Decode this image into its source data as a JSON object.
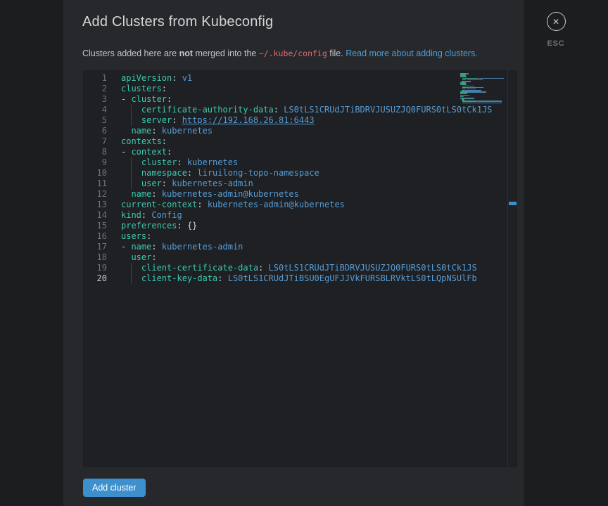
{
  "theme": {
    "accent": "#3d90ce",
    "key": "#3dc9b0",
    "value": "#569cd6",
    "punct": "#d4d4d4",
    "link_blue": "#4f9ed9",
    "code_pink": "#e06c75",
    "modal_bg": "#26282b",
    "editor_bg": "#1e2023",
    "overlay_bg": "#1b1d1f"
  },
  "modal": {
    "title": "Add Clusters from Kubeconfig",
    "close_icon": "✕",
    "esc_label": "ESC",
    "subtitle": {
      "prefix": "Clusters added here are ",
      "bold": "not",
      "middle": " merged into the ",
      "code": "~/.kube/config",
      "suffix": " file. ",
      "link": "Read more about adding clusters."
    },
    "add_button_label": "Add cluster"
  },
  "editor": {
    "active_line": 20,
    "lines": [
      {
        "no": 1,
        "tokens": [
          [
            "k",
            "apiVersion"
          ],
          [
            "p",
            ": "
          ],
          [
            "v",
            "v1"
          ]
        ]
      },
      {
        "no": 2,
        "tokens": [
          [
            "k",
            "clusters"
          ],
          [
            "p",
            ":"
          ]
        ]
      },
      {
        "no": 3,
        "tokens": [
          [
            "p",
            "- "
          ],
          [
            "k",
            "cluster"
          ],
          [
            "p",
            ":"
          ]
        ]
      },
      {
        "no": 4,
        "tokens": [
          [
            "sp",
            "  "
          ],
          [
            "g",
            ""
          ],
          [
            "k",
            "certificate-authority-data"
          ],
          [
            "p",
            ": "
          ],
          [
            "v",
            "LS0tLS1CRUdJTiBDRVJUSUZJQ0FURS0tLS0tCk1JS"
          ]
        ]
      },
      {
        "no": 5,
        "tokens": [
          [
            "sp",
            "  "
          ],
          [
            "g",
            ""
          ],
          [
            "k",
            "server"
          ],
          [
            "p",
            ": "
          ],
          [
            "l",
            "https://192.168.26.81:6443"
          ]
        ]
      },
      {
        "no": 6,
        "tokens": [
          [
            "sp",
            "  "
          ],
          [
            "k",
            "name"
          ],
          [
            "p",
            ": "
          ],
          [
            "v",
            "kubernetes"
          ]
        ]
      },
      {
        "no": 7,
        "tokens": [
          [
            "k",
            "contexts"
          ],
          [
            "p",
            ":"
          ]
        ]
      },
      {
        "no": 8,
        "tokens": [
          [
            "p",
            "- "
          ],
          [
            "k",
            "context"
          ],
          [
            "p",
            ":"
          ]
        ]
      },
      {
        "no": 9,
        "tokens": [
          [
            "sp",
            "  "
          ],
          [
            "g",
            ""
          ],
          [
            "k",
            "cluster"
          ],
          [
            "p",
            ": "
          ],
          [
            "v",
            "kubernetes"
          ]
        ]
      },
      {
        "no": 10,
        "tokens": [
          [
            "sp",
            "  "
          ],
          [
            "g",
            ""
          ],
          [
            "k",
            "namespace"
          ],
          [
            "p",
            ": "
          ],
          [
            "v",
            "liruilong-topo-namespace"
          ]
        ]
      },
      {
        "no": 11,
        "tokens": [
          [
            "sp",
            "  "
          ],
          [
            "g",
            ""
          ],
          [
            "k",
            "user"
          ],
          [
            "p",
            ": "
          ],
          [
            "v",
            "kubernetes-admin"
          ]
        ]
      },
      {
        "no": 12,
        "tokens": [
          [
            "sp",
            "  "
          ],
          [
            "k",
            "name"
          ],
          [
            "p",
            ": "
          ],
          [
            "v",
            "kubernetes-admin@kubernetes"
          ]
        ]
      },
      {
        "no": 13,
        "tokens": [
          [
            "k",
            "current-context"
          ],
          [
            "p",
            ": "
          ],
          [
            "v",
            "kubernetes-admin@kubernetes"
          ]
        ]
      },
      {
        "no": 14,
        "tokens": [
          [
            "k",
            "kind"
          ],
          [
            "p",
            ": "
          ],
          [
            "v",
            "Config"
          ]
        ]
      },
      {
        "no": 15,
        "tokens": [
          [
            "k",
            "preferences"
          ],
          [
            "p",
            ": "
          ],
          [
            "p",
            "{}"
          ]
        ]
      },
      {
        "no": 16,
        "tokens": [
          [
            "k",
            "users"
          ],
          [
            "p",
            ":"
          ]
        ]
      },
      {
        "no": 17,
        "tokens": [
          [
            "p",
            "- "
          ],
          [
            "k",
            "name"
          ],
          [
            "p",
            ": "
          ],
          [
            "v",
            "kubernetes-admin"
          ]
        ]
      },
      {
        "no": 18,
        "tokens": [
          [
            "sp",
            "  "
          ],
          [
            "k",
            "user"
          ],
          [
            "p",
            ":"
          ]
        ]
      },
      {
        "no": 19,
        "tokens": [
          [
            "sp",
            "  "
          ],
          [
            "g",
            ""
          ],
          [
            "k",
            "client-certificate-data"
          ],
          [
            "p",
            ": "
          ],
          [
            "v",
            "LS0tLS1CRUdJTiBDRVJUSUZJQ0FURS0tLS0tCk1JS"
          ]
        ]
      },
      {
        "no": 20,
        "tokens": [
          [
            "sp",
            "  "
          ],
          [
            "g",
            ""
          ],
          [
            "k",
            "client-key-data"
          ],
          [
            "p",
            ": "
          ],
          [
            "v",
            "LS0tLS1CRUdJTiBSU0EgUFJJVkFURSBLRVktLS0tLQpNSUlFb"
          ]
        ]
      }
    ]
  }
}
